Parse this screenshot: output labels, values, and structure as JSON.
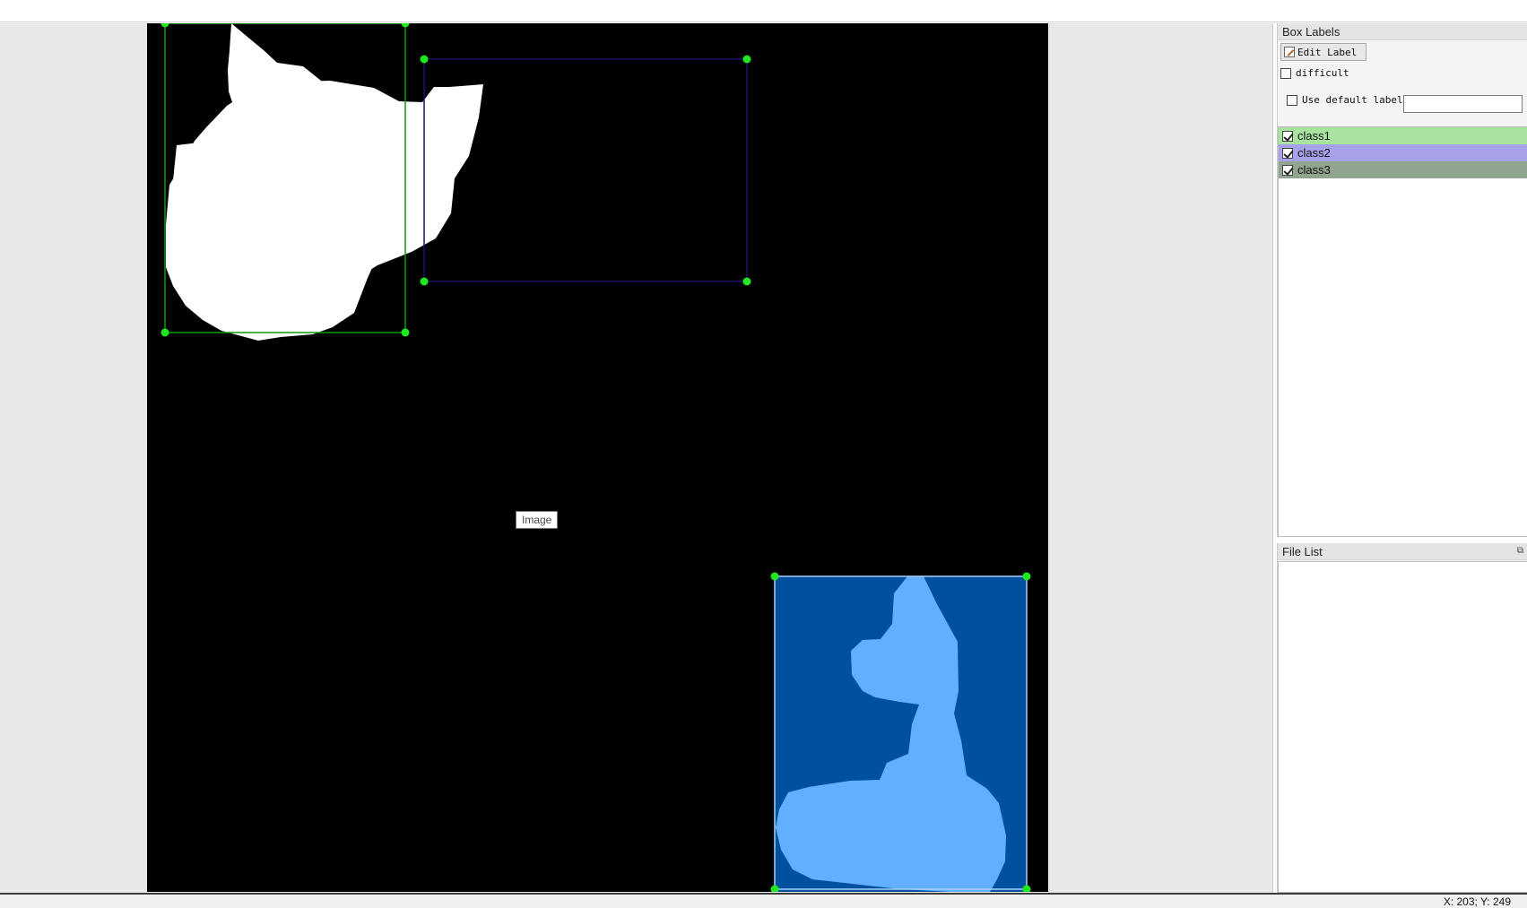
{
  "canvas": {
    "tooltip": "Image"
  },
  "box_labels_panel": {
    "title": "Box Labels",
    "edit_label_button": "Edit Label",
    "difficult_label": "difficult",
    "difficult_checked": false,
    "use_default_label": "Use default label",
    "use_default_checked": false,
    "default_label_value": "",
    "labels": [
      {
        "name": "class1",
        "checked": true,
        "color": "#a8e4a0"
      },
      {
        "name": "class2",
        "checked": true,
        "color": "#a6a1e8"
      },
      {
        "name": "class3",
        "checked": true,
        "color": "#8fa58f"
      }
    ]
  },
  "file_list_panel": {
    "title": "File List",
    "float_icon": "restore-window-icon"
  },
  "status_bar": {
    "coords": "X: 203; Y: 249"
  },
  "annotation_colors": {
    "class1_box": "#0b9c0b",
    "class2_box": "#151565",
    "class3_fill": "#0050a0",
    "class3_shape": "#62afff",
    "handle": "#1fe81f"
  }
}
